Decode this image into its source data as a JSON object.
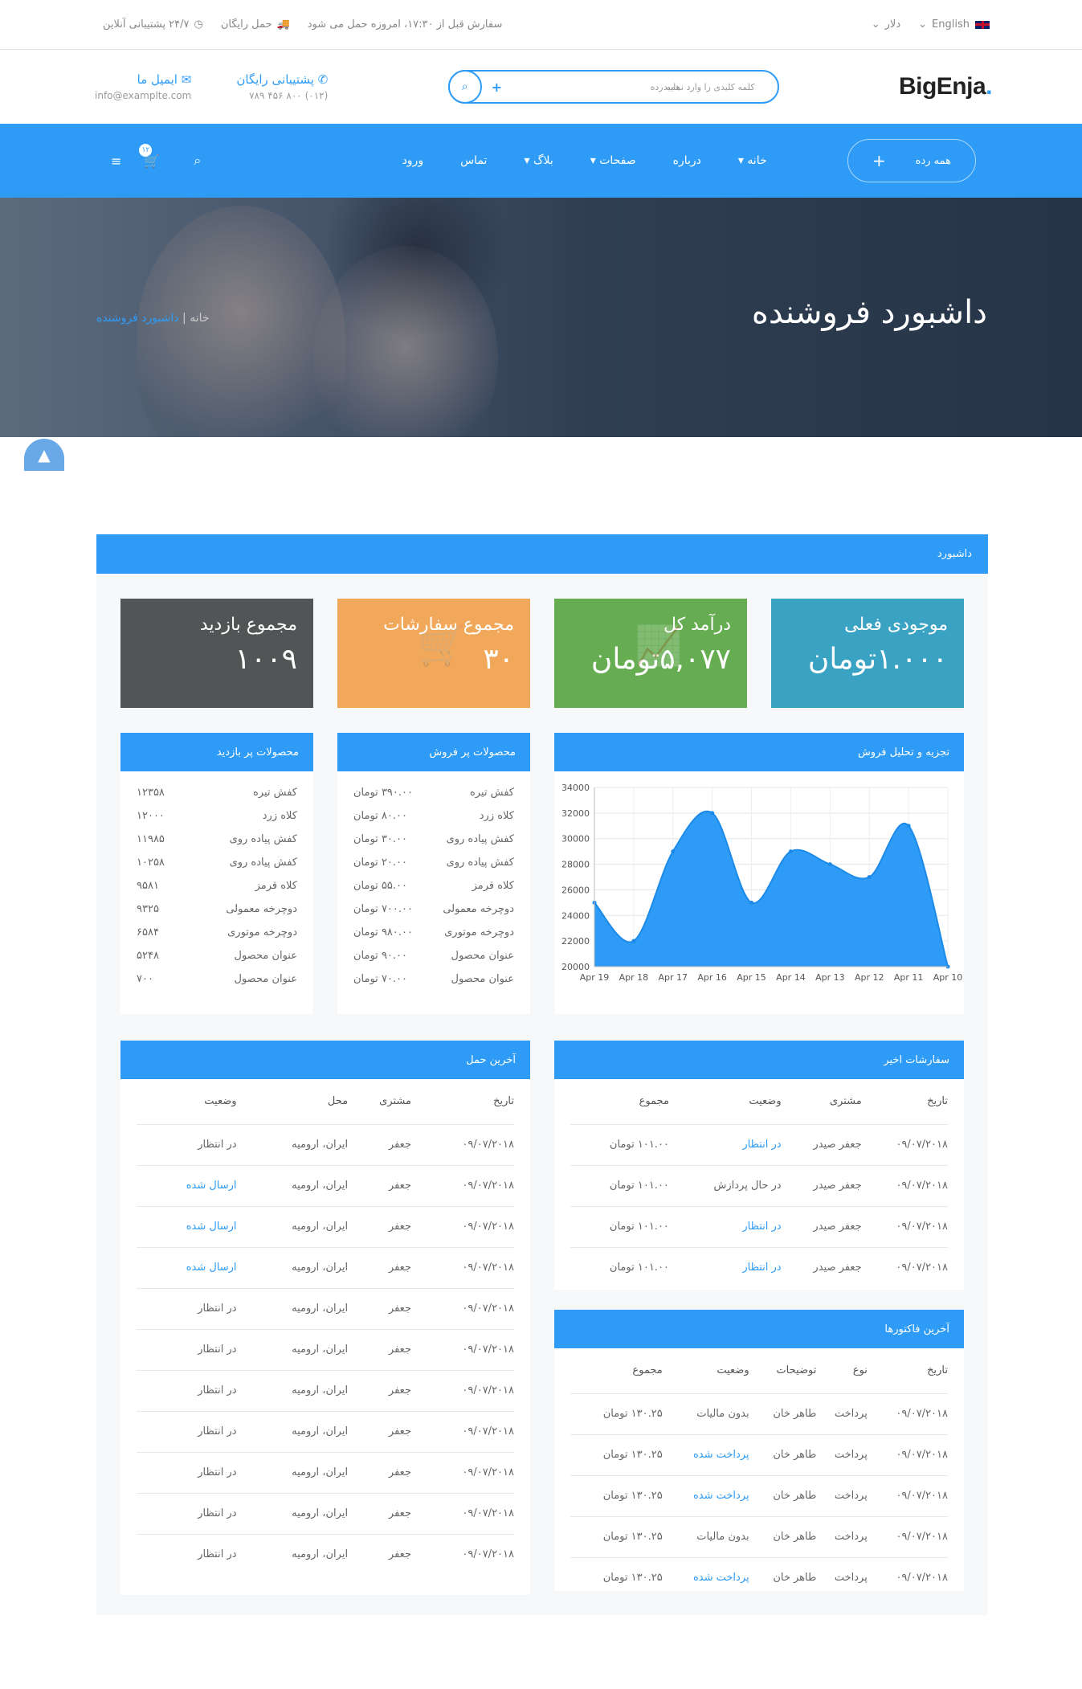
{
  "topbar": {
    "lang": "English",
    "currency": "دلار",
    "notice": "سفارش قبل از ۱۷:۳۰، امروزه حمل می شود",
    "free_ship": "حمل رایگان",
    "support": "۲۴/۷ پشتیبانی آنلاین"
  },
  "header": {
    "logo": "BigEnja",
    "logo_dot": ".",
    "search_placeholder": "کلمه کلیدی را وارد نمایید",
    "search_category": "همه رده",
    "email_title": "ایمیل ما",
    "email_value": "info@examplte.com",
    "support_title": "پشتیبانی رایگان",
    "support_phone": "(۰۱۲) ۸۰۰ ۴۵۶ ۷۸۹"
  },
  "nav": {
    "all_categories": "همه رده",
    "cart_count": "۱۲",
    "items": [
      "خانه",
      "درباره",
      "صفحات",
      "بلاگ",
      "تماس",
      "ورود"
    ]
  },
  "hero": {
    "title": "داشبورد فروشنده",
    "crumb_home": "خانه",
    "crumb_current": "داشبورد فروشنده"
  },
  "dashboard": {
    "title": "داشبورد",
    "stats": [
      {
        "title": "موجودی فعلی",
        "value": "۱.۰۰۰تومان",
        "color": "#3aa3c4"
      },
      {
        "title": "درآمد کل",
        "value": "۵,۰۷۷تومان",
        "color": "#66ad52"
      },
      {
        "title": "مجموع سفارشات",
        "value": "۳۰",
        "color": "#f2a85a"
      },
      {
        "title": "مجموع بازدید",
        "value": "۱۰۰۹",
        "color": "#525556"
      }
    ],
    "sales_title": "تجزیه و تحلیل فروش",
    "bestsellers_title": "محصولات پر فروش",
    "bestsellers": [
      {
        "name": "کفش تیره",
        "value": "۳۹۰.۰۰ تومان"
      },
      {
        "name": "کلاه زرد",
        "value": "۸۰.۰۰ تومان"
      },
      {
        "name": "کفش پیاده روی",
        "value": "۳۰.۰۰ تومان"
      },
      {
        "name": "کفش پیاده روی",
        "value": "۲۰.۰۰ تومان"
      },
      {
        "name": "کلاه قرمز",
        "value": "۵۵.۰۰ تومان"
      },
      {
        "name": "دوچرخه معمولی",
        "value": "۷۰۰.۰۰ تومان"
      },
      {
        "name": "دوچرخه موتوری",
        "value": "۹۸۰.۰۰ تومان"
      },
      {
        "name": "عنوان محصول",
        "value": "۹۰.۰۰ تومان"
      },
      {
        "name": "عنوان محصول",
        "value": "۷۰.۰۰ تومان"
      }
    ],
    "mostviewed_title": "محصولات پر بازدید",
    "mostviewed": [
      {
        "name": "کفش تیره",
        "value": "۱۲۳۵۸"
      },
      {
        "name": "کلاه زرد",
        "value": "۱۲۰۰۰"
      },
      {
        "name": "کفش پیاده روی",
        "value": "۱۱۹۸۵"
      },
      {
        "name": "کفش پیاده روی",
        "value": "۱۰۲۵۸"
      },
      {
        "name": "کلاه قرمز",
        "value": "۹۵۸۱"
      },
      {
        "name": "دوچرخه معمولی",
        "value": "۹۳۲۵"
      },
      {
        "name": "دوچرخه موتوری",
        "value": "۶۵۸۴"
      },
      {
        "name": "عنوان محصول",
        "value": "۵۲۴۸"
      },
      {
        "name": "عنوان محصول",
        "value": "۷۰۰"
      }
    ],
    "recent_orders": {
      "title": "سفارشات اخیر",
      "headers": [
        "تاریخ",
        "مشتری",
        "وضعیت",
        "مجموع"
      ],
      "rows": [
        [
          "۰۹/۰۷/۲۰۱۸",
          "جعفر صیدر",
          "در انتظار",
          "۱۰۱.۰۰ تومان"
        ],
        [
          "۰۹/۰۷/۲۰۱۸",
          "جعفر صیدر",
          "در حال پردازش",
          "۱۰۱.۰۰ تومان"
        ],
        [
          "۰۹/۰۷/۲۰۱۸",
          "جعفر صیدر",
          "در انتظار",
          "۱۰۱.۰۰ تومان"
        ],
        [
          "۰۹/۰۷/۲۰۱۸",
          "جعفر صیدر",
          "در انتظار",
          "۱۰۱.۰۰ تومان"
        ]
      ],
      "status_blue": [
        true,
        false,
        true,
        true
      ]
    },
    "invoices": {
      "title": "آخرین فاکتورها",
      "headers": [
        "تاریخ",
        "نوع",
        "توضیحات",
        "وضعیت",
        "مجموع"
      ],
      "rows": [
        [
          "۰۹/۰۷/۲۰۱۸",
          "پرداخت",
          "طاهر خان",
          "بدون مالیات",
          "۱۳۰.۲۵ تومان"
        ],
        [
          "۰۹/۰۷/۲۰۱۸",
          "پرداخت",
          "طاهر خان",
          "پرداخت شده",
          "۱۳۰.۲۵ تومان"
        ],
        [
          "۰۹/۰۷/۲۰۱۸",
          "پرداخت",
          "طاهر خان",
          "پرداخت شده",
          "۱۳۰.۲۵ تومان"
        ],
        [
          "۰۹/۰۷/۲۰۱۸",
          "پرداخت",
          "طاهر خان",
          "بدون مالیات",
          "۱۳۰.۲۵ تومان"
        ],
        [
          "۰۹/۰۷/۲۰۱۸",
          "پرداخت",
          "طاهر خان",
          "پرداخت شده",
          "۱۳۰.۲۵ تومان"
        ]
      ],
      "status_blue": [
        false,
        true,
        true,
        false,
        true
      ]
    },
    "shipping": {
      "title": "آخرین حمل",
      "headers": [
        "تاریخ",
        "مشتری",
        "محل",
        "وضعیت"
      ],
      "rows": [
        [
          "۰۹/۰۷/۲۰۱۸",
          "جعفر",
          "ایران، ارومیه",
          "در انتظار"
        ],
        [
          "۰۹/۰۷/۲۰۱۸",
          "جعفر",
          "ایران، ارومیه",
          "ارسال شده"
        ],
        [
          "۰۹/۰۷/۲۰۱۸",
          "جعفر",
          "ایران، ارومیه",
          "ارسال شده"
        ],
        [
          "۰۹/۰۷/۲۰۱۸",
          "جعفر",
          "ایران، ارومیه",
          "ارسال شده"
        ],
        [
          "۰۹/۰۷/۲۰۱۸",
          "جعفر",
          "ایران، ارومیه",
          "در انتظار"
        ],
        [
          "۰۹/۰۷/۲۰۱۸",
          "جعفر",
          "ایران، ارومیه",
          "در انتظار"
        ],
        [
          "۰۹/۰۷/۲۰۱۸",
          "جعفر",
          "ایران، ارومیه",
          "در انتظار"
        ],
        [
          "۰۹/۰۷/۲۰۱۸",
          "جعفر",
          "ایران، ارومیه",
          "در انتظار"
        ],
        [
          "۰۹/۰۷/۲۰۱۸",
          "جعفر",
          "ایران، ارومیه",
          "در انتظار"
        ],
        [
          "۰۹/۰۷/۲۰۱۸",
          "جعفر",
          "ایران، ارومیه",
          "در انتظار"
        ],
        [
          "۰۹/۰۷/۲۰۱۸",
          "جعفر",
          "ایران، ارومیه",
          "در انتظار"
        ]
      ],
      "status_blue": [
        false,
        true,
        true,
        true,
        false,
        false,
        false,
        false,
        false,
        false,
        false
      ]
    }
  },
  "chart_data": {
    "type": "area",
    "x": [
      "Apr 19",
      "Apr 18",
      "Apr 17",
      "Apr 16",
      "Apr 15",
      "Apr 14",
      "Apr 13",
      "Apr 12",
      "Apr 11",
      "Apr 10"
    ],
    "values": [
      25000,
      22000,
      29000,
      32000,
      25000,
      29000,
      28000,
      27000,
      31000,
      20000
    ],
    "ylim": [
      20000,
      34000
    ],
    "yticks": [
      20000,
      22000,
      24000,
      26000,
      28000,
      30000,
      32000,
      34000
    ],
    "color": "#2e9cf7",
    "grid": true
  }
}
